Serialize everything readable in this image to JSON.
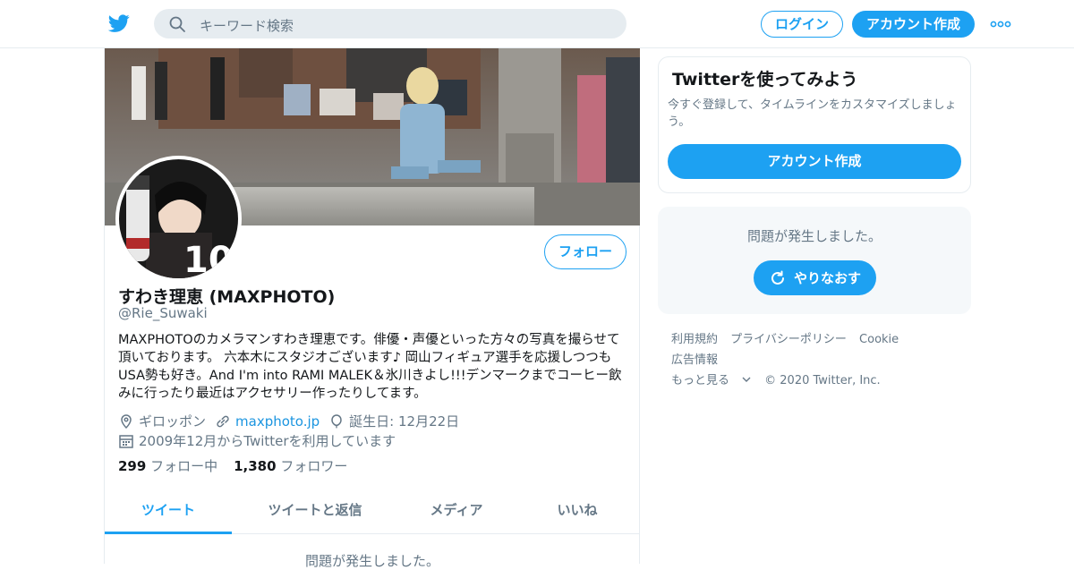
{
  "topbar": {
    "logo_icon": "twitter-bird-icon",
    "search_placeholder": "キーワード検索",
    "login_label": "ログイン",
    "signup_label": "アカウント作成",
    "more_icon": "more-dots-icon"
  },
  "profile": {
    "name": "すわき理恵 (MAXPHOTO)",
    "handle": "@Rie_Suwaki",
    "follow_label": "フォロー",
    "avatar_badge": "10",
    "bio": "MAXPHOTOのカメラマンすわき理恵です。俳優・声優といった方々の写真を撮らせて頂いております。 六本木にスタジオございます♪ 岡山フィギュア選手を応援しつつもUSA勢も好き。And I'm into RAMI MALEK＆氷川きよし!!!デンマークまでコーヒー飲みに行ったり最近はアクセサリー作ったりしてます。",
    "location": "ギロッポン",
    "website": "maxphoto.jp",
    "birthday": "誕生日: 12月22日",
    "joined": "2009年12月からTwitterを利用しています",
    "following_count": "299",
    "following_label": "フォロー中",
    "followers_count": "1,380",
    "followers_label": "フォロワー"
  },
  "tabs": [
    {
      "label": "ツイート",
      "active": true
    },
    {
      "label": "ツイートと返信",
      "active": false
    },
    {
      "label": "メディア",
      "active": false
    },
    {
      "label": "いいね",
      "active": false
    }
  ],
  "timeline": {
    "error": "問題が発生しました。"
  },
  "signup_card": {
    "title": "Twitterを使ってみよう",
    "text": "今すぐ登録して、タイムラインをカスタマイズしましょう。",
    "button": "アカウント作成"
  },
  "error_card": {
    "message": "問題が発生しました。",
    "retry": "やりなおす"
  },
  "footer": {
    "links": [
      "利用規約",
      "プライバシーポリシー",
      "Cookie",
      "広告情報",
      "もっと見る"
    ],
    "copyright": "© 2020 Twitter, Inc."
  },
  "colors": {
    "accent": "#1da1f2",
    "secondary_text": "#657786",
    "border": "#e6ecf0"
  }
}
